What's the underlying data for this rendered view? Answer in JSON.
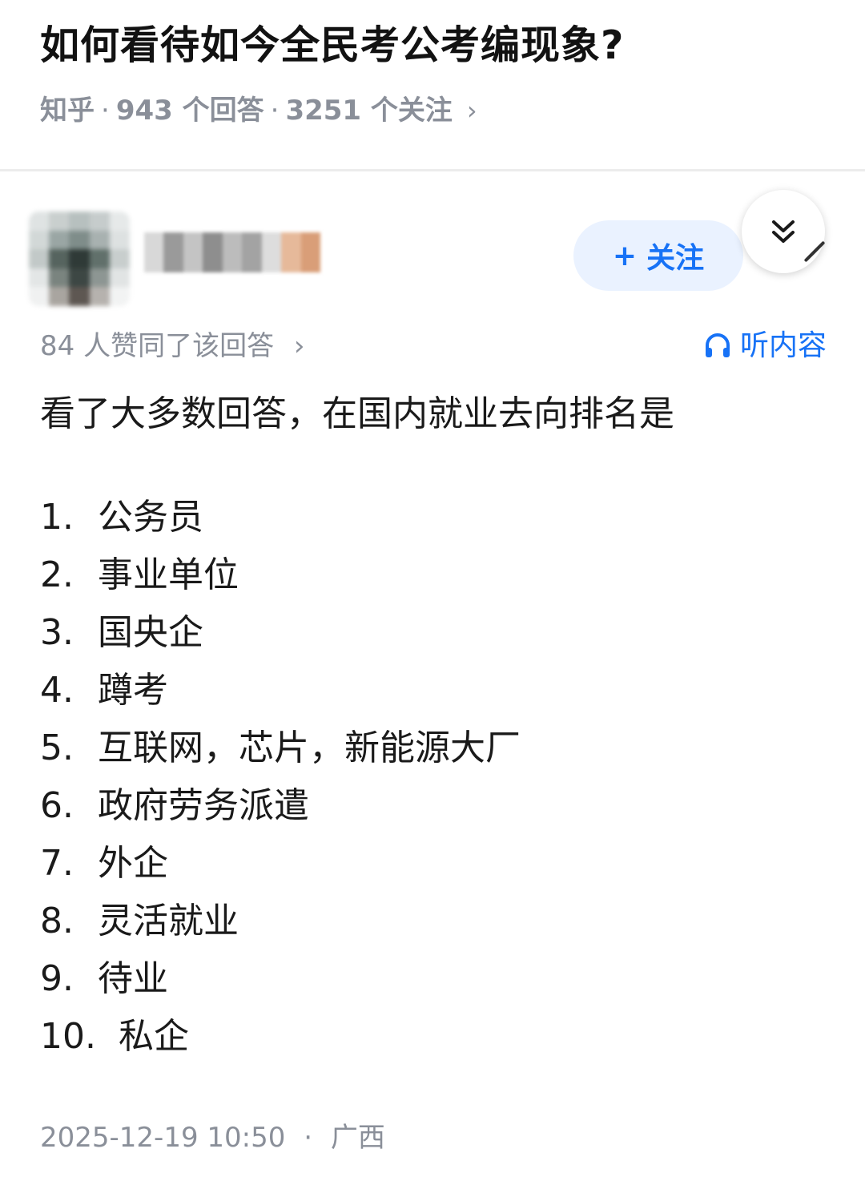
{
  "question": {
    "title": "如何看待如今全民考公考编现象?",
    "source": "知乎",
    "answers": "943 个回答",
    "followers": "3251 个关注",
    "separator": "·"
  },
  "author": {
    "follow_label": "关注",
    "follow_plus": "+"
  },
  "answer": {
    "votes": "84 人赞同了该回答",
    "listen_label": "听内容",
    "intro": "看了大多数回答，在国内就业去向排名是",
    "list": [
      {
        "num": "1.",
        "text": "公务员"
      },
      {
        "num": "2.",
        "text": "事业单位"
      },
      {
        "num": "3.",
        "text": "国央企"
      },
      {
        "num": "4.",
        "text": "蹲考"
      },
      {
        "num": "5.",
        "text": "互联网，芯片，新能源大厂"
      },
      {
        "num": "6.",
        "text": "政府劳务派遣"
      },
      {
        "num": "7.",
        "text": "外企"
      },
      {
        "num": "8.",
        "text": "灵活就业"
      },
      {
        "num": "9.",
        "text": "待业"
      },
      {
        "num": "10.",
        "text": "私企"
      }
    ],
    "datetime": "2025-12-19 10:50",
    "dot": "·",
    "location": "广西"
  },
  "colors": {
    "accent": "#1772f6",
    "meta_gray": "#8a8f99",
    "follow_bg": "#eaf2ff"
  },
  "icons": {
    "collapse": "double-chevron-down-icon",
    "listen": "headphones-icon",
    "arrow": "chevron-right-icon"
  }
}
